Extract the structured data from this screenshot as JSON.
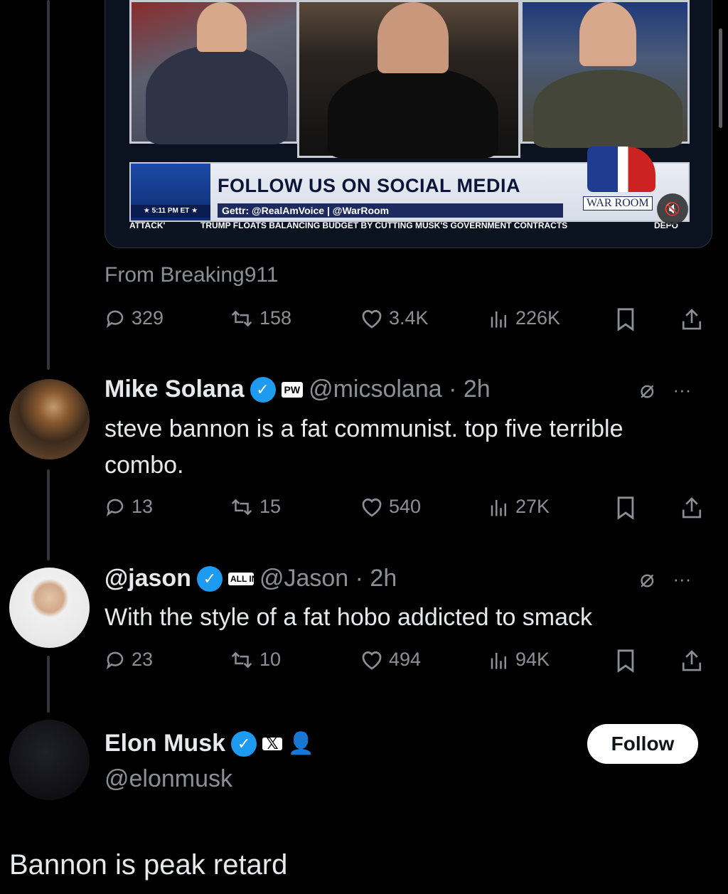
{
  "video": {
    "banner_title": "FOLLOW US ON SOCIAL MEDIA",
    "banner_sub": "Gettr: @RealAmVoice | @WarRoom",
    "banner_time": "★ 5:11 PM ET ★",
    "ticker_left": "ATTACK'",
    "ticker_main": "TRUMP FLOATS BALANCING BUDGET BY CUTTING MUSK'S GOVERNMENT CONTRACTS",
    "ticker_right": "DEPO",
    "logo_text": "WAR ROOM",
    "mute_icon": "volume-muted-icon"
  },
  "source": "From Breaking911",
  "post_actions": {
    "replies": "329",
    "reposts": "158",
    "likes": "3.4K",
    "views": "226K"
  },
  "tweets": [
    {
      "name": "Mike Solana",
      "affiliation": "PW",
      "handle": "@micsolana · 2h",
      "text": "steve bannon is a fat communist. top five terrible combo.",
      "replies": "13",
      "reposts": "15",
      "likes": "540",
      "views": "27K"
    },
    {
      "name": "@jason",
      "affiliation": "ALL IN",
      "handle": "@Jason · 2h",
      "text": "With the style of a fat hobo addicted to smack",
      "replies": "23",
      "reposts": "10",
      "likes": "494",
      "views": "94K"
    }
  ],
  "elon": {
    "name": "Elon Musk",
    "affiliation": "𝕏",
    "handle": "@elonmusk",
    "follow_label": "Follow",
    "text": "Bannon is peak retard"
  },
  "colors": {
    "background": "#000000",
    "text": "#e7e9ea",
    "muted": "#8b9096",
    "verified": "#1d9bf0",
    "line": "#333639"
  }
}
